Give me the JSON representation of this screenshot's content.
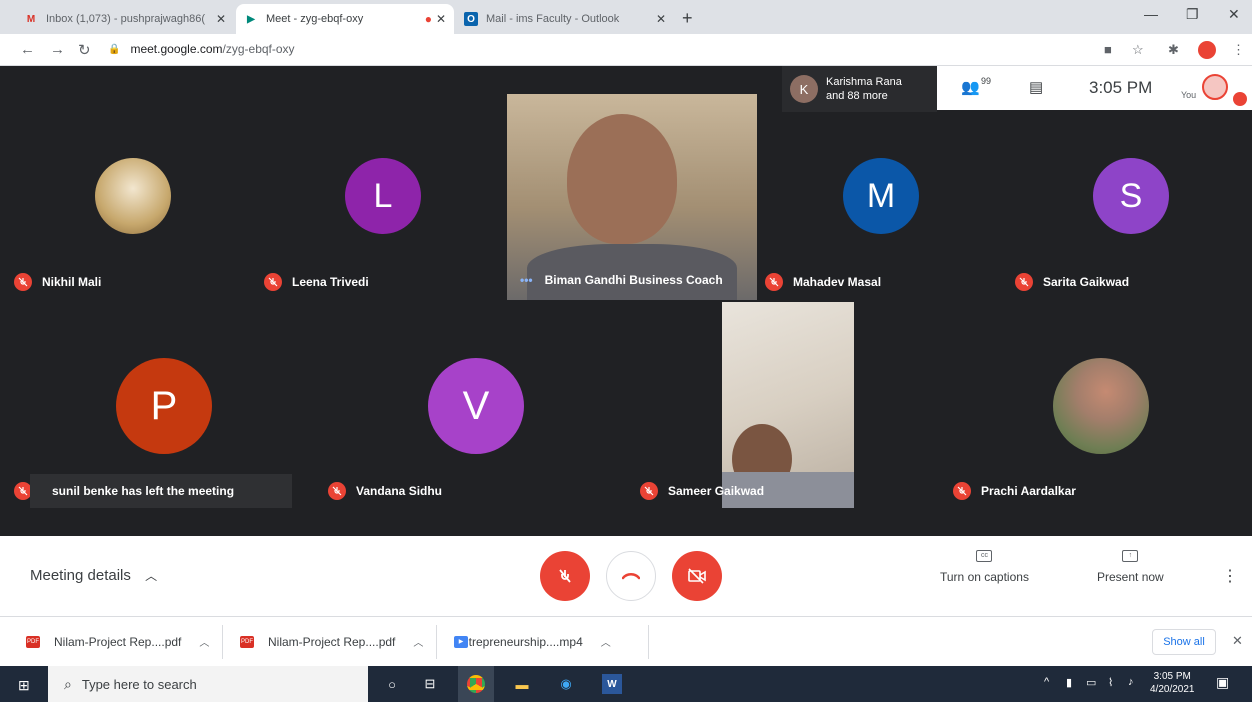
{
  "browser": {
    "tabs": [
      {
        "title": "Inbox (1,073) - pushprajwagh86(",
        "icon": "gmail-icon"
      },
      {
        "title": "Meet - zyg-ebqf-oxy",
        "icon": "meet-icon"
      },
      {
        "title": "Mail - ims Faculty - Outlook",
        "icon": "outlook-icon"
      }
    ],
    "url_host": "meet.google.com",
    "url_path": "/zyg-ebqf-oxy"
  },
  "meet": {
    "top_info": {
      "avatar_letter": "K",
      "line1": "Karishma Rana",
      "line2": "and 88 more"
    },
    "people_count": "99",
    "time": "3:05 PM",
    "you_label": "You",
    "participants": [
      {
        "name": "Nikhil Mali",
        "avatar": "image"
      },
      {
        "name": "Leena Trivedi",
        "avatar": "L",
        "color": "#8e24aa"
      },
      {
        "name": "Biman Gandhi Business Coach",
        "avatar": "video"
      },
      {
        "name": "Mahadev Masal",
        "avatar": "M",
        "color": "#0b57a8"
      },
      {
        "name": "Sarita Gaikwad",
        "avatar": "S",
        "color": "#8e44c8"
      },
      {
        "name": "",
        "avatar": "P",
        "color": "#c5390f"
      },
      {
        "name": "Vandana Sidhu",
        "avatar": "V",
        "color": "#a742c9"
      },
      {
        "name": "Sameer Gaikwad",
        "avatar": "video"
      },
      {
        "name": "Prachi Aardalkar",
        "avatar": "image"
      }
    ],
    "toast": "sunil benke has left the meeting",
    "meeting_details": "Meeting details",
    "captions_label": "Turn on captions",
    "present_label": "Present now"
  },
  "downloads": {
    "items": [
      {
        "name": "Nilam-Project Rep....pdf",
        "type": "pdf"
      },
      {
        "name": "Nilam-Project Rep....pdf",
        "type": "pdf"
      },
      {
        "name": "Entrepreneurship....mp4",
        "type": "video"
      }
    ],
    "show_all": "Show all"
  },
  "taskbar": {
    "search_placeholder": "Type here to search",
    "time": "3:05 PM",
    "date": "4/20/2021"
  },
  "colors": {
    "red": "#ea4335",
    "dark": "#202124"
  }
}
